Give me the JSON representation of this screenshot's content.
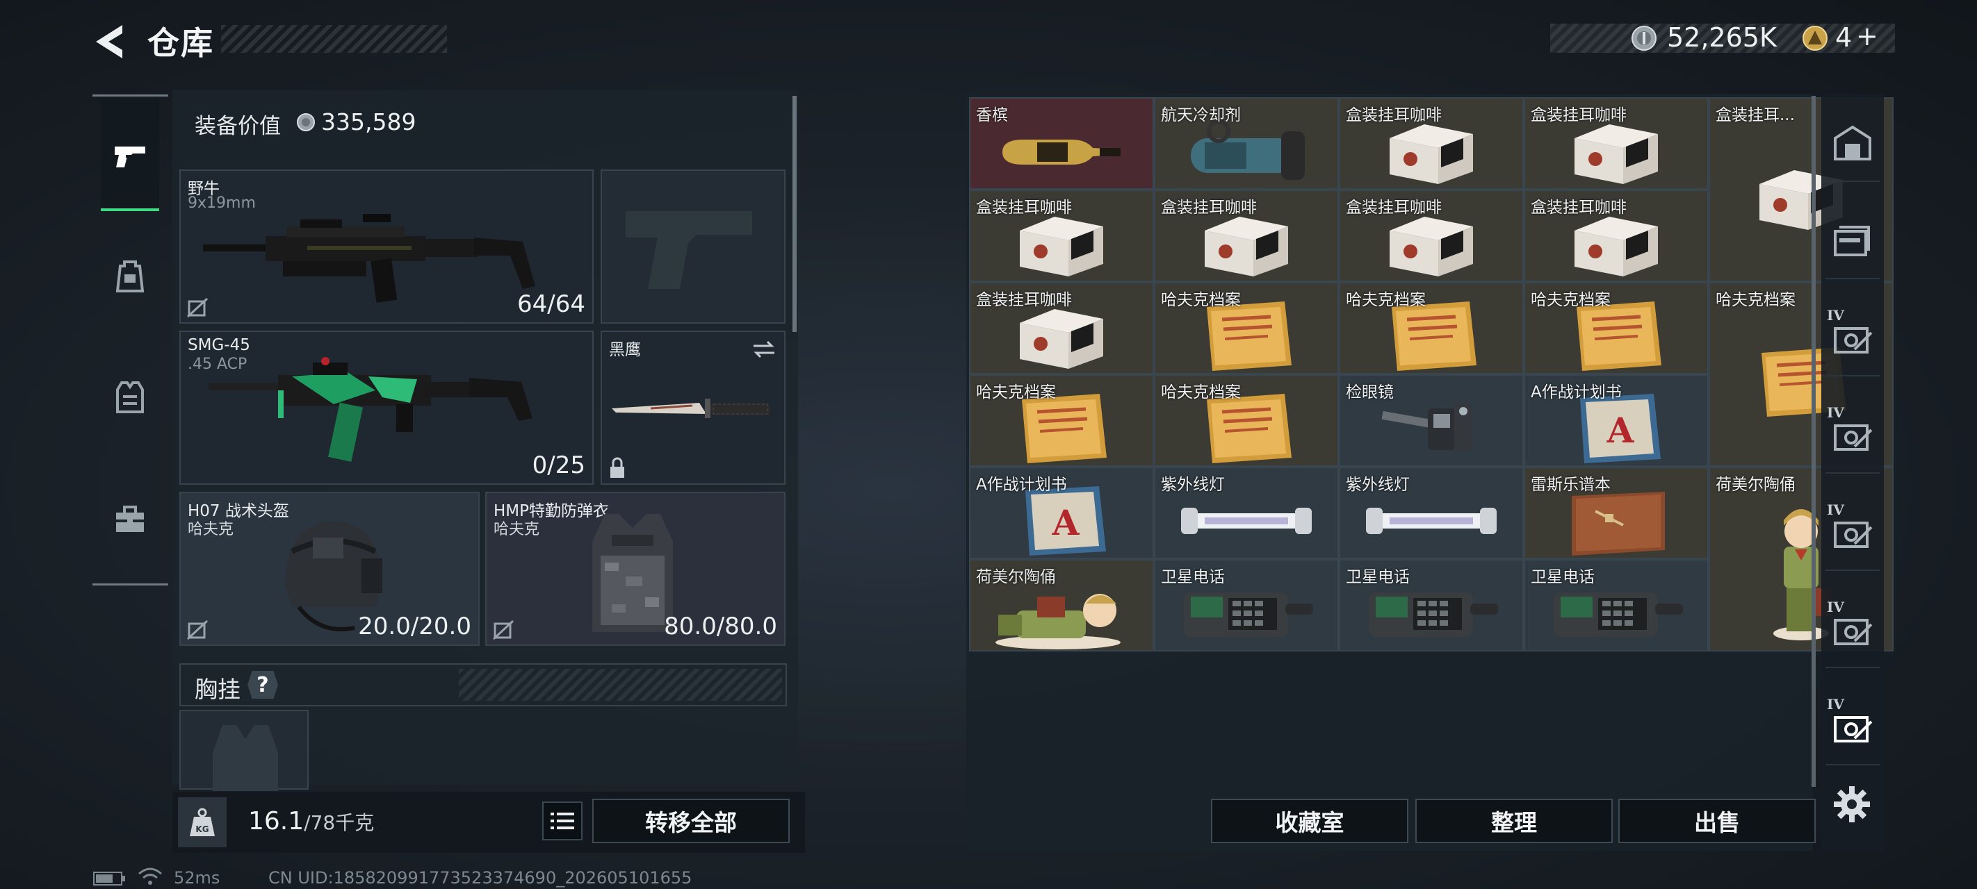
{
  "header": {
    "title": "仓库",
    "currency_amount": "52,265K",
    "ticket_amount": "4",
    "add_symbol": "+"
  },
  "equipment": {
    "value_label": "装备价值",
    "value_amount": "335,589",
    "primary_weapon": {
      "name": "野牛",
      "ammo": "9x19mm",
      "mag": "64/64"
    },
    "secondary_weapon": {
      "name": "SMG-45",
      "ammo": ".45 ACP",
      "mag": "0/25"
    },
    "melee": {
      "name": "黑鹰"
    },
    "helmet": {
      "name": "H07 战术头盔",
      "brand": "哈夫克",
      "durability": "20.0/20.0"
    },
    "armor": {
      "name": "HMP特勤防弹衣",
      "brand": "哈夫克",
      "durability": "80.0/80.0"
    },
    "chest_rig": {
      "label": "胸挂",
      "help": "?"
    }
  },
  "weight": {
    "current": "16.1",
    "max": "/78千克",
    "kg_badge": "KG"
  },
  "buttons": {
    "transfer_all": "转移全部",
    "collection_room": "收藏室",
    "organize": "整理",
    "sell": "出售"
  },
  "storage": {
    "cols": 5,
    "items": [
      {
        "name": "香槟",
        "col": 0,
        "row": 0,
        "w": 1,
        "h": 1,
        "icon": "champagne-bottle",
        "rarity_color": "#4a2a30"
      },
      {
        "name": "航天冷却剂",
        "col": 1,
        "row": 0,
        "w": 1,
        "h": 1,
        "icon": "coolant-canister",
        "rarity_color": "#3b3a33"
      },
      {
        "name": "盒装挂耳咖啡",
        "col": 2,
        "row": 0,
        "w": 1,
        "h": 1,
        "icon": "coffee-box",
        "rarity_color": "#3b3a33"
      },
      {
        "name": "盒装挂耳咖啡",
        "col": 3,
        "row": 0,
        "w": 1,
        "h": 1,
        "icon": "coffee-box",
        "rarity_color": "#3b3a33"
      },
      {
        "name": "盒装挂耳...",
        "col": 4,
        "row": 0,
        "w": 1,
        "h": 2,
        "icon": "coffee-box",
        "rarity_color": "#3b3a33"
      },
      {
        "name": "盒装挂耳咖啡",
        "col": 0,
        "row": 1,
        "w": 1,
        "h": 1,
        "icon": "coffee-box",
        "rarity_color": "#3b3a33"
      },
      {
        "name": "盒装挂耳咖啡",
        "col": 1,
        "row": 1,
        "w": 1,
        "h": 1,
        "icon": "coffee-box",
        "rarity_color": "#3b3a33"
      },
      {
        "name": "盒装挂耳咖啡",
        "col": 2,
        "row": 1,
        "w": 1,
        "h": 1,
        "icon": "coffee-box",
        "rarity_color": "#3b3a33"
      },
      {
        "name": "盒装挂耳咖啡",
        "col": 3,
        "row": 1,
        "w": 1,
        "h": 1,
        "icon": "coffee-box",
        "rarity_color": "#3b3a33"
      },
      {
        "name": "盒装挂耳咖啡",
        "col": 0,
        "row": 2,
        "w": 1,
        "h": 1,
        "icon": "coffee-box",
        "rarity_color": "#3b3a33"
      },
      {
        "name": "哈夫克档案",
        "col": 1,
        "row": 2,
        "w": 1,
        "h": 1,
        "icon": "archive-folder",
        "rarity_color": "#3b3a33"
      },
      {
        "name": "哈夫克档案",
        "col": 2,
        "row": 2,
        "w": 1,
        "h": 1,
        "icon": "archive-folder",
        "rarity_color": "#3b3a33"
      },
      {
        "name": "哈夫克档案",
        "col": 3,
        "row": 2,
        "w": 1,
        "h": 1,
        "icon": "archive-folder",
        "rarity_color": "#3b3a33"
      },
      {
        "name": "哈夫克档案",
        "col": 4,
        "row": 2,
        "w": 1,
        "h": 2,
        "icon": "archive-folder",
        "rarity_color": "#3b3a33"
      },
      {
        "name": "哈夫克档案",
        "col": 0,
        "row": 3,
        "w": 1,
        "h": 1,
        "icon": "archive-folder",
        "rarity_color": "#3b3a33"
      },
      {
        "name": "哈夫克档案",
        "col": 1,
        "row": 3,
        "w": 1,
        "h": 1,
        "icon": "archive-folder",
        "rarity_color": "#3b3a33"
      },
      {
        "name": "检眼镜",
        "col": 2,
        "row": 3,
        "w": 1,
        "h": 1,
        "icon": "ophthalmoscope",
        "rarity_color": "#2f3a42"
      },
      {
        "name": "A作战计划书",
        "col": 3,
        "row": 3,
        "w": 1,
        "h": 1,
        "icon": "plan-book",
        "rarity_color": "#2f3a42"
      },
      {
        "name": "A作战计划书",
        "col": 0,
        "row": 4,
        "w": 1,
        "h": 1,
        "icon": "plan-book",
        "rarity_color": "#2f3a42"
      },
      {
        "name": "紫外线灯",
        "col": 1,
        "row": 4,
        "w": 1,
        "h": 1,
        "icon": "uv-lamp",
        "rarity_color": "#2f3a42"
      },
      {
        "name": "紫外线灯",
        "col": 2,
        "row": 4,
        "w": 1,
        "h": 1,
        "icon": "uv-lamp",
        "rarity_color": "#2f3a42"
      },
      {
        "name": "雷斯乐谱本",
        "col": 3,
        "row": 4,
        "w": 1,
        "h": 1,
        "icon": "music-book",
        "rarity_color": "#3b3a33"
      },
      {
        "name": "荷美尔陶俑",
        "col": 4,
        "row": 4,
        "w": 1,
        "h": 2,
        "icon": "ceramic-figurine",
        "rarity_color": "#3b3a33"
      },
      {
        "name": "荷美尔陶俑",
        "col": 0,
        "row": 5,
        "w": 1,
        "h": 1,
        "icon": "ceramic-figurine-lying",
        "rarity_color": "#3b3a33"
      },
      {
        "name": "卫星电话",
        "col": 1,
        "row": 5,
        "w": 1,
        "h": 1,
        "icon": "satellite-phone",
        "rarity_color": "#2f3a42"
      },
      {
        "name": "卫星电话",
        "col": 2,
        "row": 5,
        "w": 1,
        "h": 1,
        "icon": "satellite-phone",
        "rarity_color": "#2f3a42"
      },
      {
        "name": "卫星电话",
        "col": 3,
        "row": 5,
        "w": 1,
        "h": 1,
        "icon": "satellite-phone",
        "rarity_color": "#2f3a42"
      }
    ]
  },
  "right_nav": [
    {
      "icon": "storage-room-icon",
      "badge": ""
    },
    {
      "icon": "folder-stack-icon",
      "badge": ""
    },
    {
      "icon": "safe-box-icon",
      "badge": "IV"
    },
    {
      "icon": "safe-box-icon",
      "badge": "IV"
    },
    {
      "icon": "safe-box-icon",
      "badge": "IV"
    },
    {
      "icon": "safe-box-icon",
      "badge": "IV"
    },
    {
      "icon": "safe-box-icon",
      "badge": "IV"
    }
  ],
  "status": {
    "ping": "52ms",
    "uid": "CN UID:185820991773523374690_202605101655"
  },
  "colors": {
    "accent_green": "#3ddc84",
    "panel_bg": "#1c242c"
  }
}
